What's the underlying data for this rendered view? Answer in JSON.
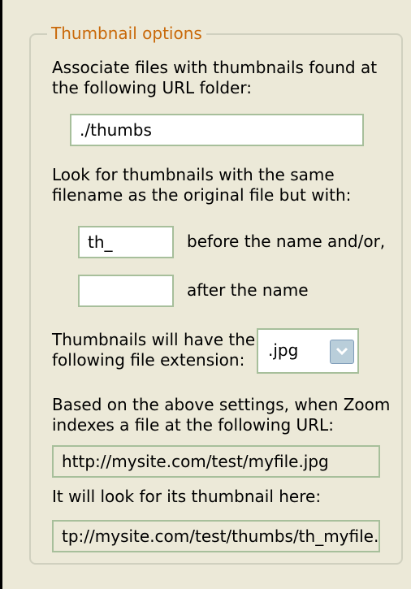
{
  "group": {
    "title": "Thumbnail options"
  },
  "associate": {
    "line1": "Associate files with thumbnails found at",
    "line2": "the following URL folder:",
    "folder_value": "./thumbs"
  },
  "lookfor": {
    "line1": "Look for thumbnails with the same",
    "line2": "filename as the original file but with:"
  },
  "prefix": {
    "value": "th_",
    "label": "before the name and/or,"
  },
  "suffix": {
    "value": "",
    "label": "after the name"
  },
  "extension": {
    "line1": "Thumbnails will have the",
    "line2": "following file extension:",
    "selected": ".jpg",
    "dropdown_icon": "chevron-down-icon"
  },
  "example": {
    "line1": "Based on the above settings, when Zoom",
    "line2": "indexes a file at the following URL:",
    "url": "http://mysite.com/test/myfile.jpg",
    "result_label": "It will look for its thumbnail here:",
    "result_url": "tp://mysite.com/test/thumbs/th_myfile.jpg"
  }
}
